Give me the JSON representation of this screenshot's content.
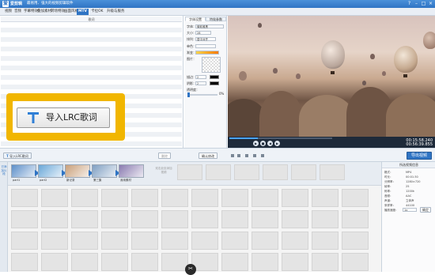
{
  "app": {
    "name": "爱剪辑",
    "slogan": "最易用、强大的视频剪辑软件"
  },
  "window_buttons": [
    "?",
    "–",
    "□",
    "×"
  ],
  "menu": [
    {
      "label": "视频",
      "active": false
    },
    {
      "label": "音频",
      "active": false
    },
    {
      "label": "字幕特效",
      "active": false
    },
    {
      "label": "叠加素材",
      "active": false
    },
    {
      "label": "转场特效",
      "active": false
    },
    {
      "label": "画面风格",
      "active": false
    },
    {
      "label": "MTV",
      "active": true
    },
    {
      "label": "卡拉OK",
      "active": false
    },
    {
      "label": "升级与服务",
      "active": false
    }
  ],
  "lrc_panel": {
    "header": "歌词"
  },
  "settings": {
    "tabs": [
      "字体设置",
      "特效参数"
    ],
    "font_label": "字体：",
    "font_value": "微软雅黑",
    "size_label": "大小：",
    "size_value": "28",
    "layout_label": "排列：",
    "layout_value": "居中对齐",
    "color_label": "单色：",
    "gradient_label": "渐变：",
    "image_label": "图片：",
    "stroke_label": "描边：",
    "stroke_value": "2",
    "shadow_label": "阴影：",
    "shadow_value": "2",
    "opacity_label": "透明度：",
    "opacity_value": "0%",
    "gradient_colors": [
      "#ffd54a",
      "#ff7a00"
    ]
  },
  "player": {
    "time_current": "00:15:58.240",
    "time_total": "00:56:39.855",
    "progress": 0.28
  },
  "midbar": {
    "import_lrc": "导入LRC歌词",
    "delete": "删除",
    "confirm": "确认修改",
    "export": "导出视频"
  },
  "callout": {
    "icon": "T",
    "text": "导入LRC歌词"
  },
  "sidetab": "已添加片段",
  "clips": [
    {
      "label": "part1",
      "color": "#5d8fc9"
    },
    {
      "label": "part2",
      "color": "#6aa8d8"
    },
    {
      "label": "新记录",
      "color": "#c9a07a"
    },
    {
      "label": "第三集",
      "color": "#7f9fc2"
    },
    {
      "label": "我用素材",
      "color": "#8a7bb0"
    }
  ],
  "add_hint": "双击此处添加视频",
  "properties": {
    "title": "所选视频信息",
    "rows": [
      {
        "label": "格式：",
        "value": "MP4"
      },
      {
        "label": "时长：",
        "value": "00:01:30"
      },
      {
        "label": "分辨率：",
        "value": "1280×720"
      },
      {
        "label": "帧率：",
        "value": "25"
      },
      {
        "label": "码率：",
        "value": "1200k"
      },
      {
        "label": "音频：",
        "value": "AAC"
      },
      {
        "label": "声道：",
        "value": "立体声"
      },
      {
        "label": "采样率：",
        "value": "44100"
      }
    ],
    "speed_label": "播放速度：",
    "speed_value": "1x",
    "apply_label": "确定"
  }
}
